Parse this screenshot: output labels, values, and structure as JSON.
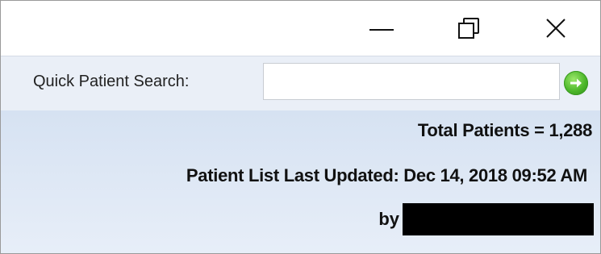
{
  "window_controls": {
    "minimize_icon": "minimize-icon",
    "restore_icon": "restore-icon",
    "close_icon": "close-icon"
  },
  "search": {
    "label": "Quick Patient Search:",
    "value": "",
    "placeholder": "",
    "go_icon": "green-arrow-go-icon"
  },
  "info": {
    "total_patients": "Total Patients = 1,288",
    "last_updated": "Patient List Last Updated: Dec 14, 2018 09:52 AM",
    "by_label": "by"
  },
  "colors": {
    "panel_top": "#d6e2f2",
    "panel_bottom": "#e7eef8",
    "search_bar": "#eaeff7",
    "go_green": "#4cb62a"
  }
}
